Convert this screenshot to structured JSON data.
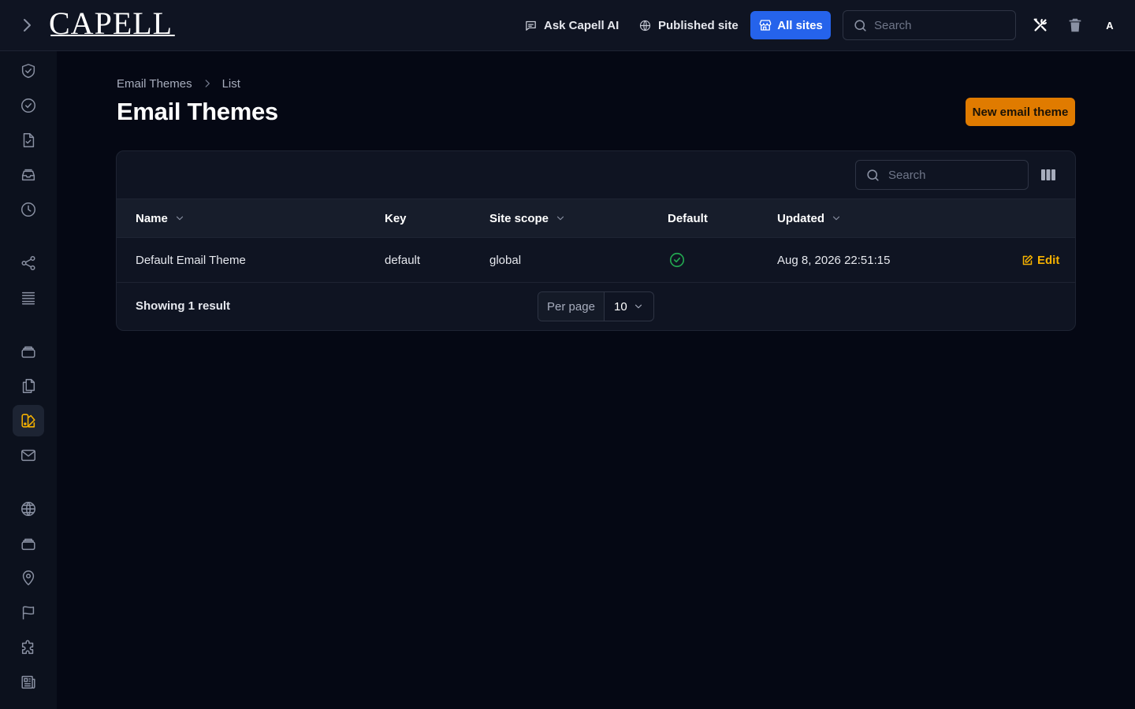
{
  "brand": {
    "logo_text": "CAPELL"
  },
  "topbar": {
    "ask_ai_label": "Ask Capell AI",
    "published_site_label": "Published site",
    "all_sites_label": "All sites",
    "search_placeholder": "Search",
    "avatar_initial": "A"
  },
  "sidebar": {
    "items": [
      {
        "icon": "shield-check-icon"
      },
      {
        "icon": "check-circle-icon"
      },
      {
        "icon": "document-check-icon"
      },
      {
        "icon": "inbox-stack-icon"
      },
      {
        "icon": "clock-icon"
      },
      {
        "icon": "share-icon"
      },
      {
        "icon": "queue-list-icon"
      },
      {
        "icon": "rectangle-stack-icon"
      },
      {
        "icon": "document-duplicate-icon"
      },
      {
        "icon": "swatch-icon",
        "active": true
      },
      {
        "icon": "envelope-icon"
      },
      {
        "icon": "globe-icon"
      },
      {
        "icon": "rectangle-stack-icon"
      },
      {
        "icon": "map-pin-icon"
      },
      {
        "icon": "flag-icon"
      },
      {
        "icon": "puzzle-piece-icon"
      },
      {
        "icon": "newspaper-icon"
      }
    ]
  },
  "breadcrumb": {
    "items": [
      "Email Themes",
      "List"
    ]
  },
  "page": {
    "title": "Email Themes",
    "new_button_label": "New email theme"
  },
  "table": {
    "search_placeholder": "Search",
    "columns": {
      "name": "Name",
      "key": "Key",
      "site_scope": "Site scope",
      "default": "Default",
      "updated": "Updated"
    },
    "rows": [
      {
        "name": "Default Email Theme",
        "key": "default",
        "site_scope": "global",
        "default": true,
        "updated": "Aug 8, 2026 22:51:15",
        "action_label": "Edit"
      }
    ],
    "footer": {
      "count_text": "Showing 1 result",
      "per_page_label": "Per page",
      "per_page_value": "10"
    }
  },
  "colors": {
    "accent": "#f5b100",
    "primary_button": "#e07b00",
    "all_sites_button": "#2563eb",
    "success": "#22a650",
    "background": "#050814"
  }
}
